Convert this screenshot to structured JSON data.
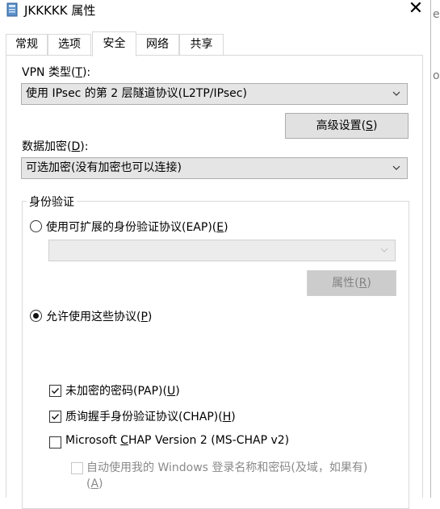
{
  "window": {
    "title": "JKKKKK 属性",
    "close_glyph": "✕"
  },
  "background_window": {
    "text_fragments": [
      "er",
      "o"
    ]
  },
  "tabs": [
    {
      "label": "常规",
      "active": false
    },
    {
      "label": "选项",
      "active": false
    },
    {
      "label": "安全",
      "active": true
    },
    {
      "label": "网络",
      "active": false
    },
    {
      "label": "共享",
      "active": false
    }
  ],
  "vpn_type": {
    "label": "VPN 类型(",
    "accel": "T",
    "label_end": "):",
    "selected": "使用 IPsec 的第 2 层隧道协议(L2TP/IPsec)"
  },
  "advanced_button": {
    "label": "高级设置(",
    "accel": "S",
    "label_end": ")"
  },
  "encryption": {
    "label": "数据加密(",
    "accel": "D",
    "label_end": "):",
    "selected": "可选加密(没有加密也可以连接)"
  },
  "auth": {
    "legend": "身份验证",
    "eap_radio": {
      "label": "使用可扩展的身份验证协议(EAP)(",
      "accel": "E",
      "label_end": ")",
      "checked": false
    },
    "eap_combo_value": "",
    "properties_button": {
      "label": "属性(",
      "accel": "R",
      "label_end": ")",
      "enabled": false
    },
    "allow_radio": {
      "label": "允许使用这些协议(",
      "accel": "P",
      "label_end": ")",
      "checked": true
    },
    "protocols": [
      {
        "label": "未加密的密码(PAP)(",
        "accel": "U",
        "label_end": ")",
        "checked": true
      },
      {
        "label": "质询握手身份验证协议(CHAP)(",
        "accel": "H",
        "label_end": ")",
        "checked": true
      },
      {
        "label_pre": "Microsoft ",
        "accel": "C",
        "label": "HAP Version 2 (MS-CHAP v2)",
        "checked": false
      }
    ],
    "auto_logon": {
      "label": "自动使用我的 Windows 登录名称和密码(及域，如果有)",
      "label_line2_pre": "(",
      "accel": "A",
      "label_line2_end": ")",
      "checked": false,
      "enabled": false
    }
  },
  "colors": {
    "border": "#d9d9d9",
    "control_bg": "#e5e5e5",
    "button_bg": "#e1e1e1",
    "disabled_text": "#8a8a8a"
  }
}
